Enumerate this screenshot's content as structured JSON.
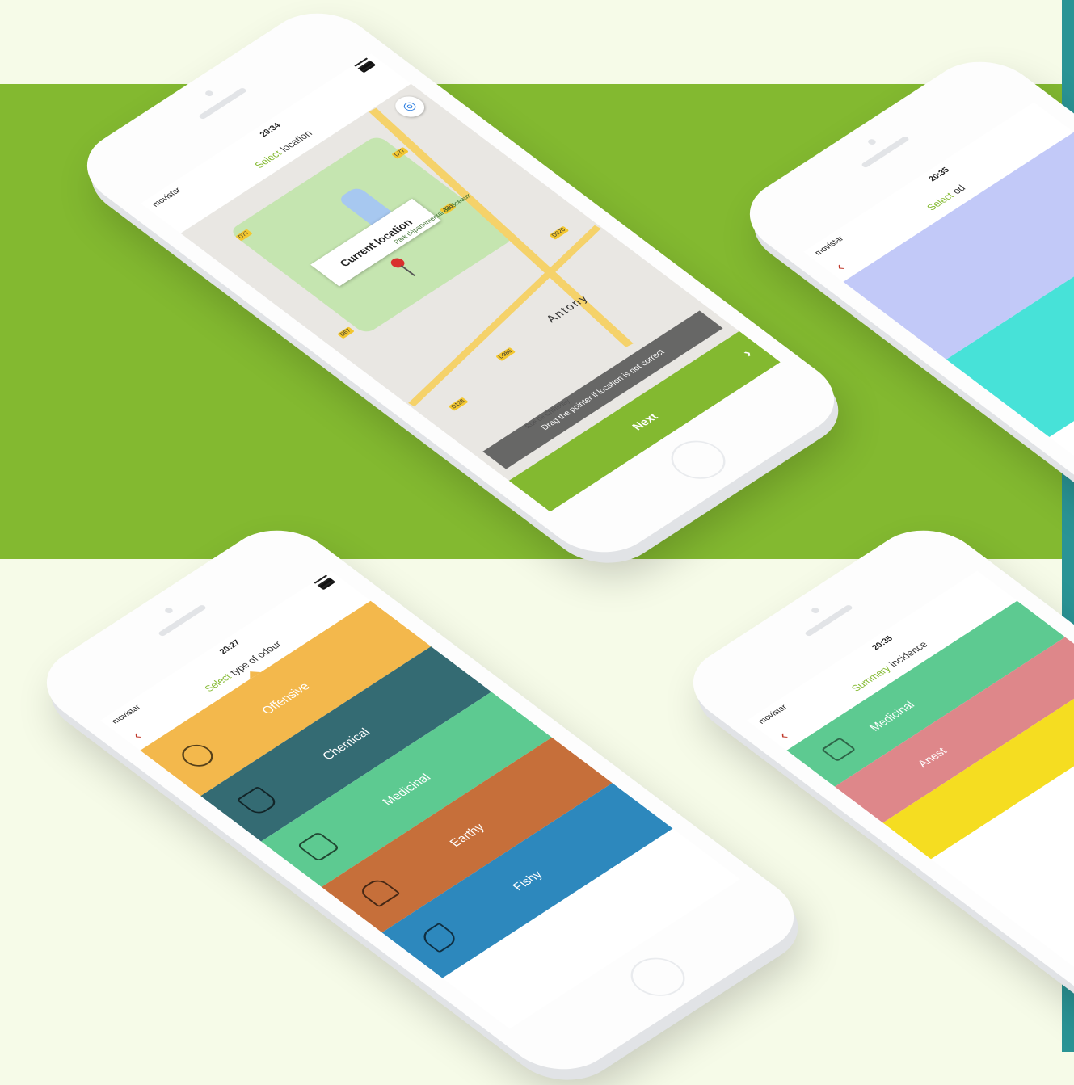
{
  "colors": {
    "brand_green": "#83b930",
    "page_bg": "#f6fbe8",
    "teal_edge": "#2a9495",
    "back_arrow": "#c0392b"
  },
  "status": {
    "carrier": "movistar"
  },
  "phone_map": {
    "time": "20:34",
    "title_accent": "Select",
    "title_rest": "location",
    "callout": "Current location",
    "park_label": "Park départemental de Sceaux",
    "city_label": "Antony",
    "street_label": "Rue de Châtenay",
    "road_tags": [
      "D77",
      "D67",
      "A86",
      "D920",
      "D986",
      "D128",
      "D77"
    ],
    "toast": "Drag the pointer if location is not correct",
    "next_label": "Next",
    "icons": [
      "menu-icon",
      "locate-icon",
      "pin-icon",
      "chevron-right-icon"
    ]
  },
  "phone_odour": {
    "time": "20:27",
    "title_accent": "Select",
    "title_rest": "type of odour",
    "items": [
      {
        "label": "Offensive",
        "color": "#f3b84c",
        "icon": "face-icon"
      },
      {
        "label": "Chemical",
        "color": "#346b73",
        "icon": "flask-icon"
      },
      {
        "label": "Medicinal",
        "color": "#5dca91",
        "icon": "first-aid-kit-icon"
      },
      {
        "label": "Earthy",
        "color": "#c66f3a",
        "icon": "tree-icon"
      },
      {
        "label": "Fishy",
        "color": "#2d88bd",
        "icon": "fish-icon"
      }
    ]
  },
  "phone_select_partial": {
    "time": "20:35",
    "title_accent": "Select",
    "title_rest": "od",
    "tiles": [
      {
        "color": "#c2c9f8"
      },
      {
        "color": "#47e2d8"
      }
    ]
  },
  "phone_summary_partial": {
    "time": "20:35",
    "title_accent": "Summary",
    "title_rest": "incidence",
    "items": [
      {
        "label": "Medicinal",
        "color": "#5dca91"
      },
      {
        "label": "Anest",
        "color": "#de878a"
      },
      {
        "label": "",
        "color": "#f5dd21"
      }
    ]
  }
}
